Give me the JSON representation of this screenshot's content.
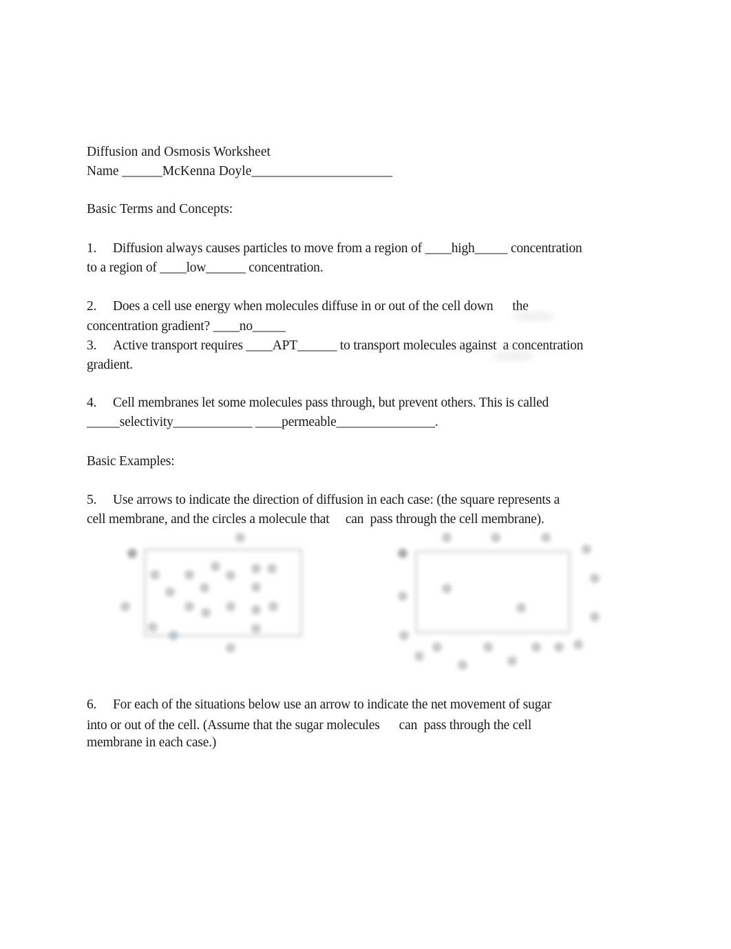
{
  "title": "Diffusion and Osmosis Worksheet",
  "name_line": "Name ______McKenna Doyle_____________________",
  "section_basic_terms": "Basic Terms and Concepts:",
  "q1": {
    "number": "1.",
    "line1": "Diffusion always causes particles to move from a region of ____high_____ concentration",
    "line2": "to a region of ____low______ concentration."
  },
  "q2": {
    "number": "2.",
    "line1": "Does a cell use energy when molecules diffuse in or out of the cell down      the",
    "line2": "concentration gradient? ____no_____"
  },
  "q3": {
    "number": "3.",
    "line1": "Active transport requires ____APT______ to transport molecules against  a concentration",
    "line2": "gradient."
  },
  "q4": {
    "number": "4.",
    "line1": "Cell membranes let some molecules pass through, but prevent others. This is called",
    "line2": "_____selectivity____________ ____permeable_______________."
  },
  "section_basic_examples": "Basic Examples:",
  "q5": {
    "number": "5.",
    "line1": "Use arrows to indicate the direction of diffusion in each case: (the square represents a",
    "line2": "cell membrane, and the circles a molecule that     can  pass through the cell membrane)."
  },
  "q6": {
    "number": "6.",
    "line1": "For each of the situations below use an arrow to indicate the net movement of sugar",
    "line2": "into or out of the cell. (Assume that the sugar molecules      can  pass through the cell",
    "line3": "membrane in each case.)"
  }
}
